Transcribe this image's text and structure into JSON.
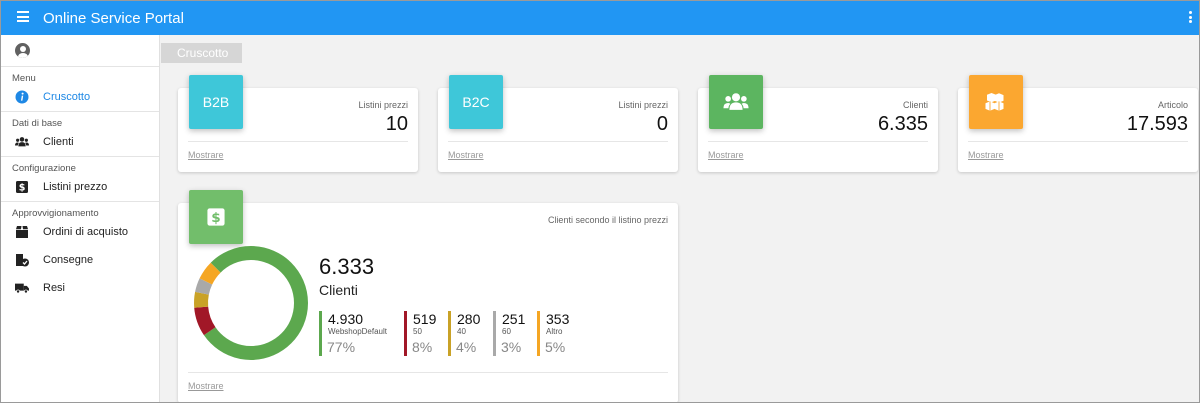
{
  "header": {
    "title": "Online Service Portal",
    "menu_icon": "hamburger-icon",
    "more_icon": "kebab-icon",
    "color": "#2196f3"
  },
  "sidebar": {
    "sections": [
      {
        "label": "Menu",
        "items": [
          {
            "label": "Cruscotto",
            "icon": "info-icon",
            "active": true
          }
        ]
      },
      {
        "label": "Dati di base",
        "items": [
          {
            "label": "Clienti",
            "icon": "users-icon"
          }
        ]
      },
      {
        "label": "Configurazione",
        "items": [
          {
            "label": "Listini prezzo",
            "icon": "dollar-icon"
          }
        ]
      },
      {
        "label": "Approvvigionamento",
        "items": [
          {
            "label": "Ordini di acquisto",
            "icon": "box-icon"
          },
          {
            "label": "Consegne",
            "icon": "delivery-icon"
          },
          {
            "label": "Resi",
            "icon": "truck-icon"
          }
        ]
      }
    ]
  },
  "tab": "Cruscotto",
  "cards": [
    {
      "tile": "B2B",
      "caption": "Listini prezzi",
      "value": "10",
      "link": "Mostrare"
    },
    {
      "tile": "B2C",
      "caption": "Listini prezzi",
      "value": "0",
      "link": "Mostrare"
    },
    {
      "icon": "users-icon",
      "caption": "Clienti",
      "value": "6.335",
      "link": "Mostrare"
    },
    {
      "icon": "cubes-icon",
      "caption": "Articolo",
      "value": "17.593",
      "link": "Mostrare"
    }
  ],
  "pricelist_card": {
    "icon": "dollar-icon",
    "subtitle": "Clienti secondo il listino prezzi",
    "total": "6.333",
    "total_label": "Clienti",
    "link": "Mostrare",
    "segments": [
      {
        "value": "4.930",
        "name": "WebshopDefault",
        "percent": "77%",
        "color": "#5ca84e"
      },
      {
        "value": "519",
        "name": "50",
        "percent": "8%",
        "color": "#a11727"
      },
      {
        "value": "280",
        "name": "40",
        "percent": "4%",
        "color": "#c9a227"
      },
      {
        "value": "251",
        "name": "60",
        "percent": "3%",
        "color": "#a9a9a9"
      },
      {
        "value": "353",
        "name": "Altro",
        "percent": "5%",
        "color": "#f5a623"
      }
    ]
  }
}
